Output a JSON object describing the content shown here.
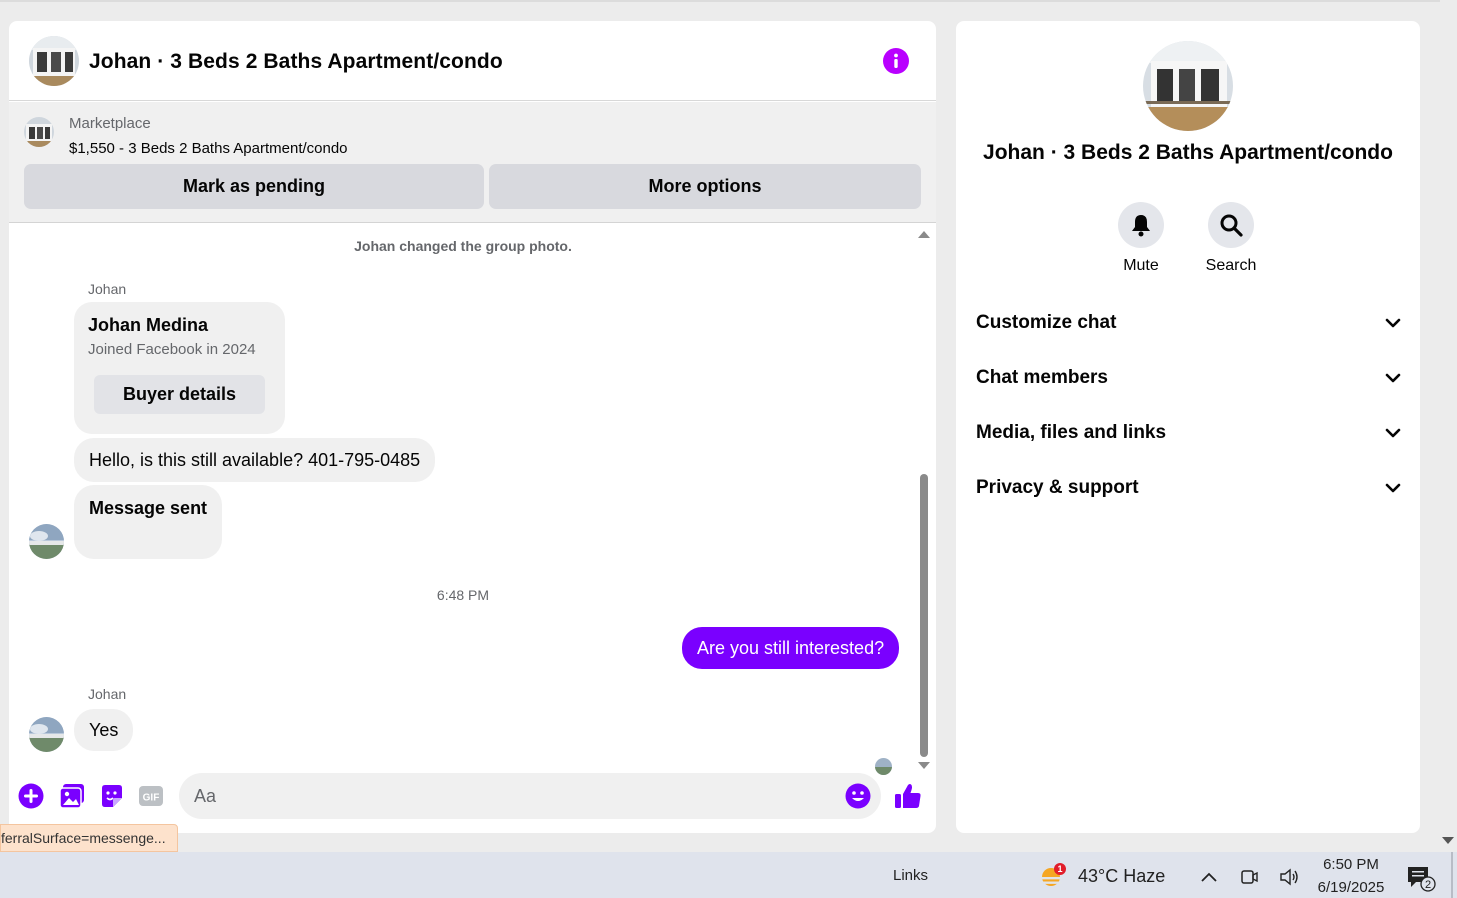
{
  "chat": {
    "title": "Johan · 3 Beds 2 Baths Apartment/condo",
    "listing": {
      "source": "Marketplace",
      "price_title": "$1,550 - 3 Beds 2 Baths Apartment/condo",
      "mark_pending_label": "Mark as pending",
      "more_options_label": "More options"
    },
    "messages": {
      "system": "Johan changed the group photo.",
      "sender_1": "Johan",
      "card_name": "Johan Medina",
      "card_sub": "Joined Facebook in 2024",
      "card_button": "Buyer details",
      "msg_1": "Hello, is this still available? 401-795-0485",
      "msg_2": "Message sent",
      "timestamp": "6:48 PM",
      "msg_out": "Are you still interested?",
      "sender_2": "Johan",
      "msg_3": "Yes"
    },
    "composer": {
      "placeholder": "Aa",
      "gif_label": "GIF"
    }
  },
  "url_status": "ferralSurface=messenge...",
  "info": {
    "title": "Johan · 3 Beds 2 Baths Apartment/condo",
    "mute_label": "Mute",
    "search_label": "Search",
    "sections": [
      "Customize chat",
      "Chat members",
      "Media, files and links",
      "Privacy & support"
    ]
  },
  "taskbar": {
    "links": "Links",
    "weather": "43°C  Haze",
    "weather_badge": "1",
    "time": "6:50 PM",
    "date": "6/19/2025",
    "notif_count": "2"
  },
  "colors": {
    "accent": "#7a00ff",
    "info_icon": "#b900ff",
    "bubble_gray": "#f0f0f0"
  }
}
